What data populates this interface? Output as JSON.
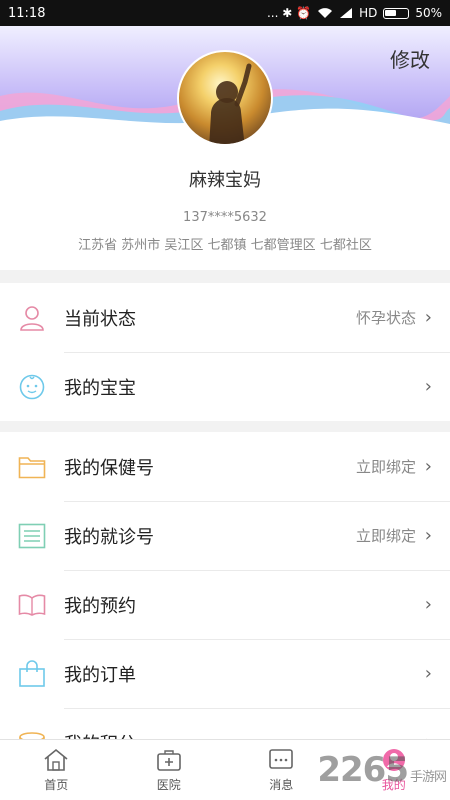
{
  "status_bar": {
    "time": "11:18",
    "indicators": "... ✱ ⏰",
    "network": "HD",
    "battery": "50%"
  },
  "header": {
    "edit_label": "修改"
  },
  "profile": {
    "nickname": "麻辣宝妈",
    "phone": "137****5632",
    "address": "江苏省 苏州市 吴江区 七都镇 七都管理区 七都社区"
  },
  "menu_group_1": [
    {
      "label": "当前状态",
      "value": "怀孕状态",
      "icon": "person-icon"
    },
    {
      "label": "我的宝宝",
      "value": "",
      "icon": "baby-face-icon"
    }
  ],
  "menu_group_2": [
    {
      "label": "我的保健号",
      "value": "立即绑定",
      "icon": "folder-icon"
    },
    {
      "label": "我的就诊号",
      "value": "立即绑定",
      "icon": "document-list-icon"
    },
    {
      "label": "我的预约",
      "value": "",
      "icon": "book-icon"
    },
    {
      "label": "我的订单",
      "value": "",
      "icon": "shopping-bag-icon"
    },
    {
      "label": "我的积分",
      "value": "",
      "icon": "coins-icon"
    }
  ],
  "tabs": [
    {
      "label": "首页",
      "icon": "home-icon"
    },
    {
      "label": "医院",
      "icon": "medical-kit-icon"
    },
    {
      "label": "消息",
      "icon": "message-icon"
    },
    {
      "label": "我的",
      "icon": "user-icon",
      "active": true
    }
  ],
  "watermark": {
    "text": "2265",
    "sub": "手游网"
  },
  "colors": {
    "accent": "#e8559c",
    "wave_purple": "#b9a4f5",
    "wave_pink": "#f3a6d6",
    "wave_blue": "#8fd2f4"
  }
}
